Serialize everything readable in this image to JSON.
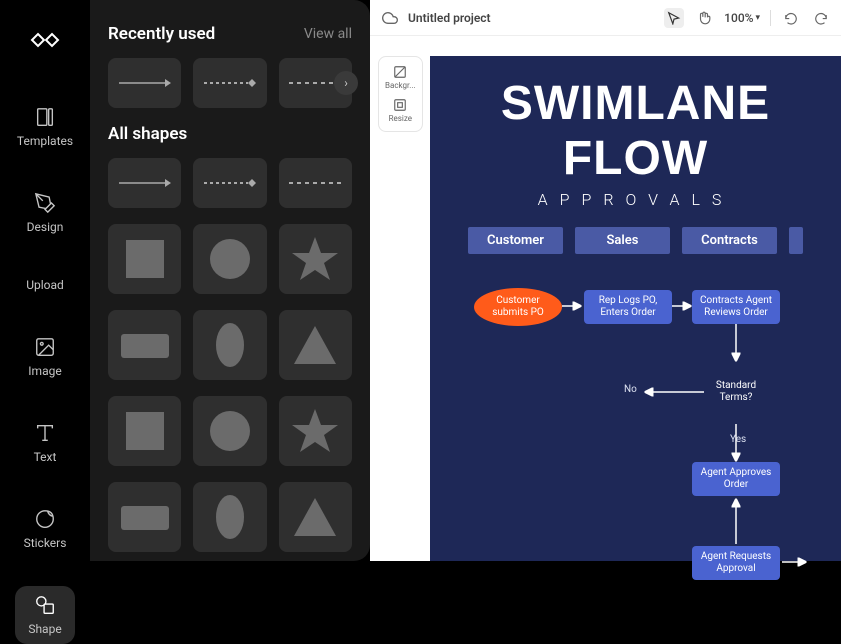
{
  "nav": {
    "items": [
      {
        "label": "Templates"
      },
      {
        "label": "Design"
      },
      {
        "label": "Upload"
      },
      {
        "label": "Image"
      },
      {
        "label": "Text"
      },
      {
        "label": "Stickers"
      },
      {
        "label": "Shape"
      }
    ]
  },
  "panel": {
    "recently_title": "Recently used",
    "view_all": "View all",
    "all_shapes_title": "All shapes"
  },
  "topbar": {
    "project_title": "Untitled project",
    "zoom": "100%"
  },
  "side_tools": {
    "background": "Backgr...",
    "resize": "Resize"
  },
  "design": {
    "title": "SWIMLANE FLOW",
    "subtitle": "APPROVALS",
    "lanes": [
      "Customer",
      "Sales",
      "Contracts"
    ],
    "nodes": {
      "customer_submits": "Customer\nsubmits PO",
      "rep_logs": "Rep Logs PO,\nEnters Order",
      "contracts_agent": "Contracts Agent\nReviews Order",
      "standard_terms": "Standard\nTerms?",
      "agent_approves": "Agent Approves\nOrder",
      "agent_requests": "Agent Requests\nApproval"
    },
    "labels": {
      "no": "No",
      "yes": "Yes"
    }
  }
}
